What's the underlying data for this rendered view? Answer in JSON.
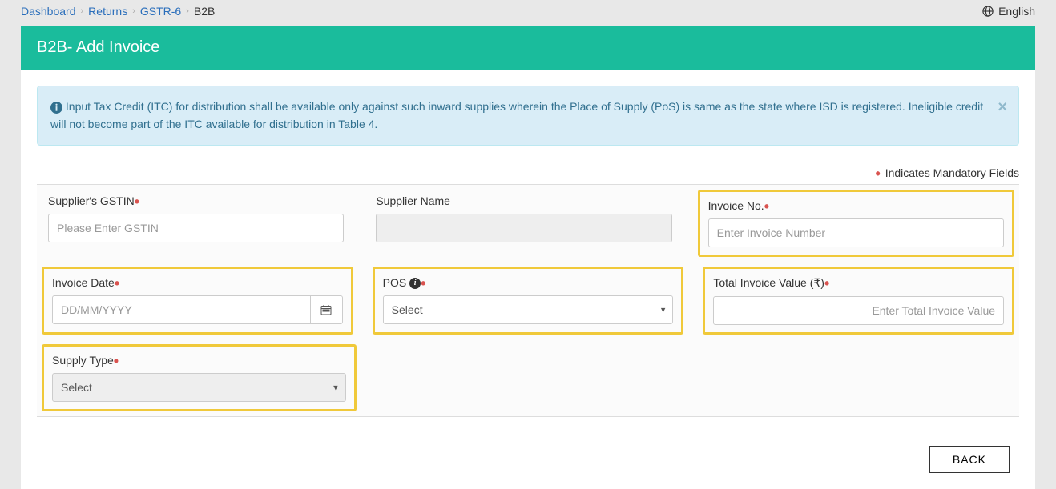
{
  "breadcrumb": {
    "dashboard": "Dashboard",
    "returns": "Returns",
    "gstr6": "GSTR-6",
    "current": "B2B"
  },
  "lang": {
    "label": "English"
  },
  "header": {
    "title": "B2B- Add Invoice"
  },
  "info": {
    "text": "Input Tax Credit (ITC) for distribution shall be available only against such inward supplies wherein the Place of Supply (PoS) is same as the state where ISD is registered. Ineligible credit will not become part of the ITC available for distribution in Table 4."
  },
  "mandatory_note": "Indicates Mandatory Fields",
  "form": {
    "supplier_gstin": {
      "label": "Supplier's GSTIN",
      "placeholder": "Please Enter GSTIN"
    },
    "supplier_name": {
      "label": "Supplier Name"
    },
    "invoice_no": {
      "label": "Invoice No.",
      "placeholder": "Enter Invoice Number"
    },
    "invoice_date": {
      "label": "Invoice Date",
      "placeholder": "DD/MM/YYYY"
    },
    "pos": {
      "label": "POS",
      "selected": "Select"
    },
    "total_value": {
      "label": "Total Invoice Value (₹)",
      "placeholder": "Enter Total Invoice Value"
    },
    "supply_type": {
      "label": "Supply Type",
      "selected": "Select"
    }
  },
  "buttons": {
    "back": "BACK"
  }
}
